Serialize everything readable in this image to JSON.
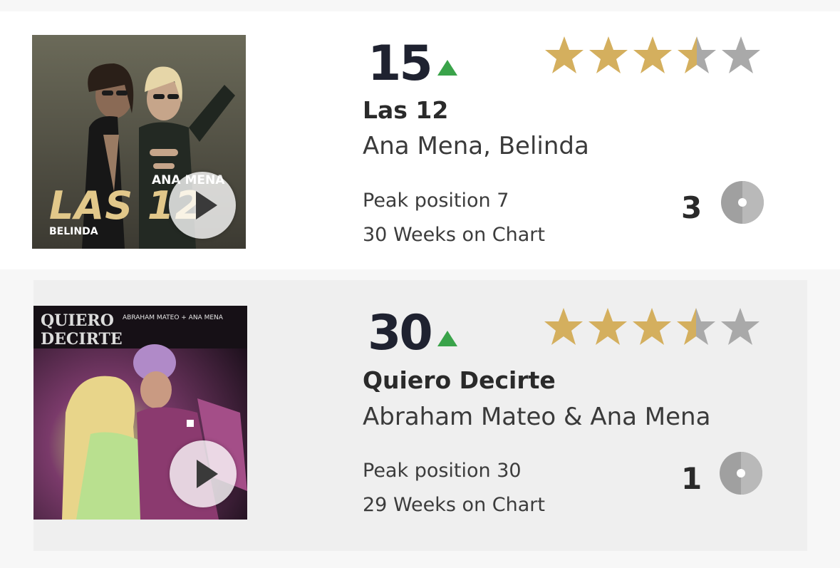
{
  "entries": [
    {
      "rank": "15",
      "trend": "up",
      "rating": 4.5,
      "title": "Las 12",
      "artist": "Ana Mena, Belinda",
      "peak": "Peak position 7",
      "weeks": "30 Weeks on Chart",
      "disc_count": "3",
      "cover": {
        "line1": "ANA MENA",
        "line2": "LAS 12",
        "line3": "BELINDA"
      }
    },
    {
      "rank": "30",
      "trend": "up",
      "rating": 4.5,
      "title": "Quiero Decirte",
      "artist": "Abraham Mateo & Ana Mena",
      "peak": "Peak position 30",
      "weeks": "29 Weeks on Chart",
      "disc_count": "1",
      "cover": {
        "line1": "QUIERO DECIRTE",
        "line2": "ABRAHAM MATEO + ANA MENA"
      }
    }
  ],
  "colors": {
    "star_filled": "#d4af5e",
    "star_empty": "#a9a9a9",
    "trend_up": "#3aa34a",
    "disc": "#a0a0a0"
  },
  "icons": {
    "play": "play-icon",
    "star": "star-icon",
    "disc": "disc-icon",
    "trend": "arrow-up-icon"
  }
}
